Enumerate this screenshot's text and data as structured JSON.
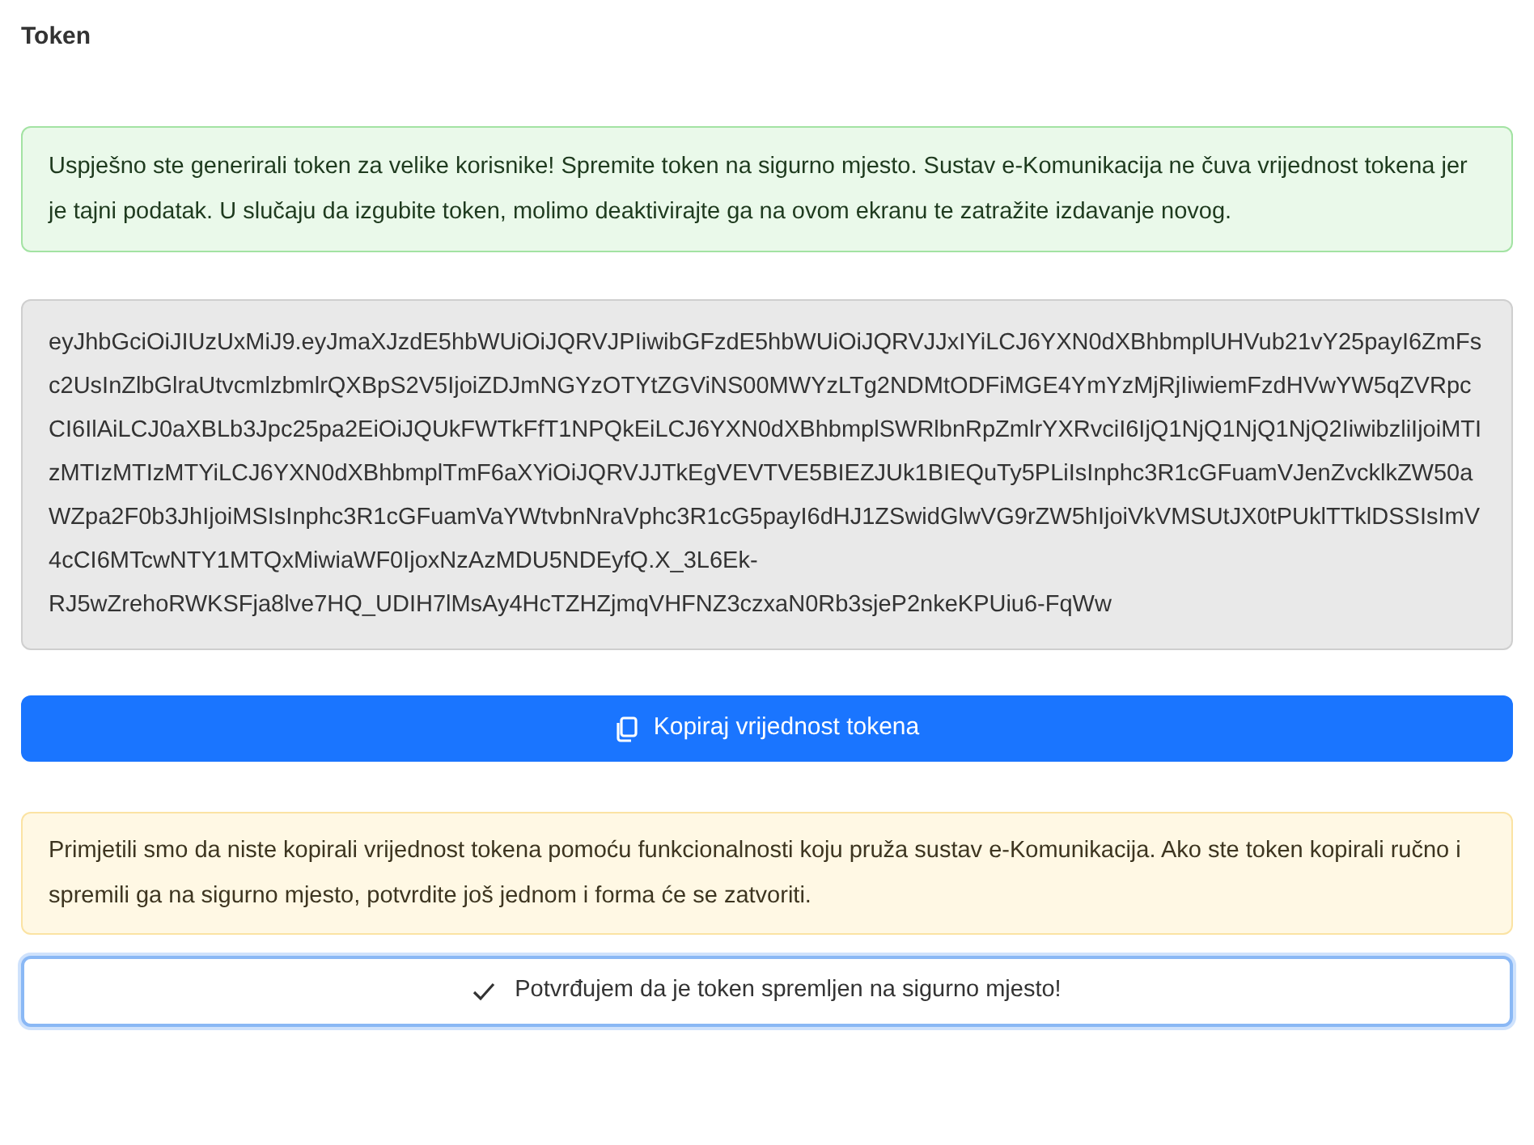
{
  "title": "Token",
  "success_alert": "Uspješno ste generirali token za velike korisnike! Spremite token na sigurno mjesto. Sustav e-Komunikacija ne čuva vrijednost tokena jer je tajni podatak. U slučaju da izgubite token, molimo deaktivirajte ga na ovom ekranu te zatražite izdavanje novog.",
  "token_value": "eyJhbGciOiJIUzUxMiJ9.eyJmaXJzdE5hbWUiOiJQRVJPIiwibGFzdE5hbWUiOiJQRVJJxIYiLCJ6YXN0dXBhbmplUHVub21vY25payI6ZmFsc2UsInZlbGlraUtvcmlzbmlrQXBpS2V5IjoiZDJmNGYzOTYtZGViNS00MWYzLTg2NDMtODFiMGE4YmYzMjRjIiwiemFzdHVwYW5qZVRpcCI6IlAiLCJ0aXBLb3Jpc25pa2EiOiJQUkFWTkFfT1NPQkEiLCJ6YXN0dXBhbmplSWRlbnRpZmlrYXRvciI6IjQ1NjQ1NjQ1NjQ2IiwibzliIjoiMTIzMTIzMTIzMTYiLCJ6YXN0dXBhbmplTmF6aXYiOiJQRVJJTkEgVEVTVE5BIEZJUk1BIEQuTy5PLiIsInphc3R1cGFuamVJenZvcklkZW50aWZpa2F0b3JhIjoiMSIsInphc3R1cGFuamVaYWtvbnNraVphc3R1cG5payI6dHJ1ZSwidGlwVG9rZW5hIjoiVkVMSUtJX0tPUklTTklDSSIsImV4cCI6MTcwNTY1MTQxMiwiaWF0IjoxNzAzMDU5NDEyfQ.X_3L6Ek-RJ5wZrehoRWKSFja8lve7HQ_UDIH7lMsAy4HcTZHZjmqVHFNZ3czxaN0Rb3sjeP2nkeKPUiu6-FqWw",
  "copy_button": "Kopiraj vrijednost tokena",
  "warning_alert": "Primjetili smo da niste kopirali vrijednost tokena pomoću funkcionalnosti koju pruža sustav e-Komunikacija. Ako ste token kopirali ručno i spremili ga na sigurno mjesto, potvrdite još jednom i forma će se zatvoriti.",
  "confirm_button": {
    "label": "Potvrđujem da je token spremljen na sigurno mjesto!",
    "focused": true
  }
}
